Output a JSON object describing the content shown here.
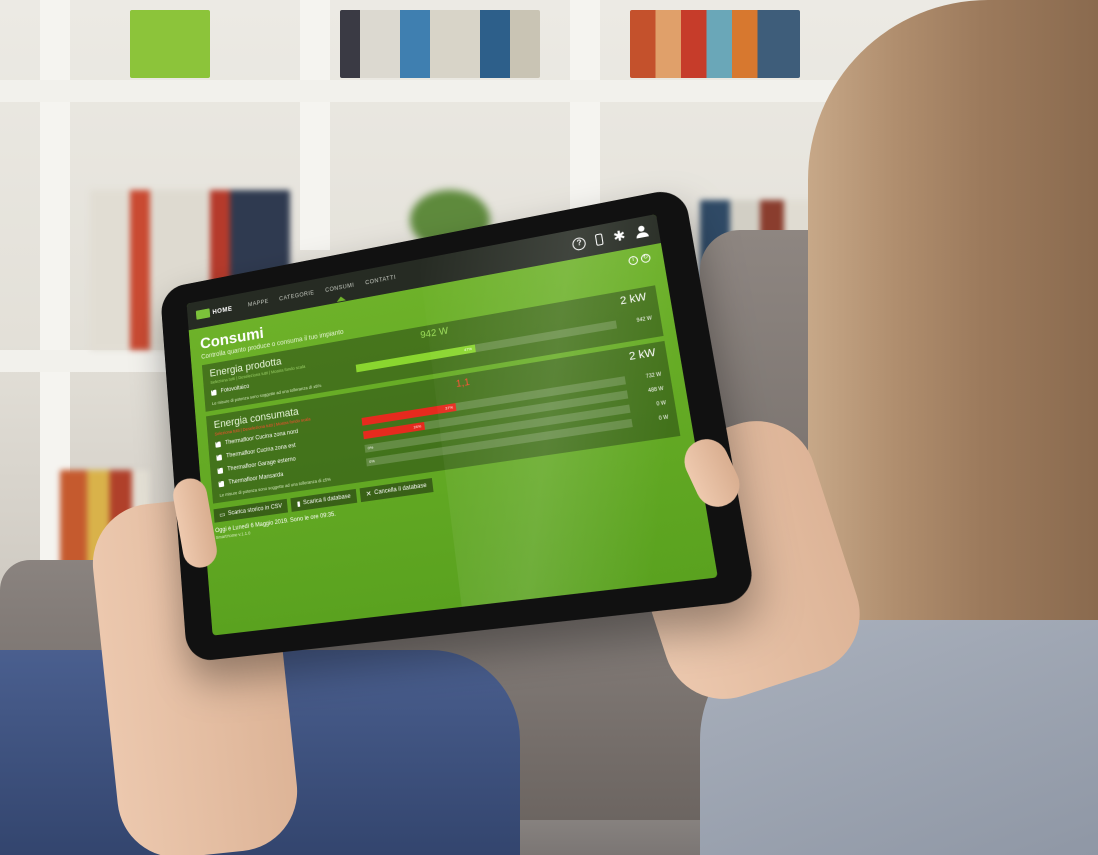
{
  "app": {
    "logo_text": "HOME",
    "nav": [
      "MAPPE",
      "CATEGORIE",
      "CONSUMI",
      "CONTATTI"
    ],
    "active_nav": "CONSUMI"
  },
  "page": {
    "title": "Consumi",
    "subtitle": "Controlla quanto produce o consuma il tuo impianto"
  },
  "produced": {
    "title": "Energia prodotta",
    "filters": "Seleziona tutti | Deseleziona tutti | Mostra fondo scala",
    "current": "942 W",
    "max": "2 kW",
    "items": [
      {
        "label": "Fotovoltaico",
        "percent": 47,
        "percent_label": "47%",
        "value": "942 W"
      }
    ],
    "note": "Le misure di potenza sono soggette ad una tolleranza di ±5%"
  },
  "consumed": {
    "title": "Energia consumata",
    "filters": "Seleziona tutti | Deseleziona tutti | Mostra fondo scala",
    "current": "1,1",
    "max": "2 kW",
    "items": [
      {
        "label": "Thermafloor Cucina zona nord",
        "percent": 37,
        "percent_label": "37%",
        "value": "732 W"
      },
      {
        "label": "Thermafloor Cucina zona est",
        "percent": 24,
        "percent_label": "24%",
        "value": "488 W"
      },
      {
        "label": "Thermafloor Garage esterno",
        "percent": 0,
        "percent_label": "0%",
        "value": "0 W"
      },
      {
        "label": "Thermafloor Mansarda",
        "percent": 0,
        "percent_label": "0%",
        "value": "0 W"
      }
    ],
    "note": "Le misure di potenza sono soggette ad una tolleranza di ±5%"
  },
  "actions": {
    "csv": "Scarica storico in CSV",
    "db": "Scarica il database",
    "delete": "Cancella il database"
  },
  "footer": {
    "date": "Oggi è Lunedì 6 Maggio 2019. Sono le ore 09:35.",
    "version": "SmartHome v.1.1.0"
  },
  "colors": {
    "screen_green": "#6fb32a",
    "topbar": "#262b23",
    "bar_green": "#8ad62f",
    "bar_red": "#e62a1e"
  }
}
